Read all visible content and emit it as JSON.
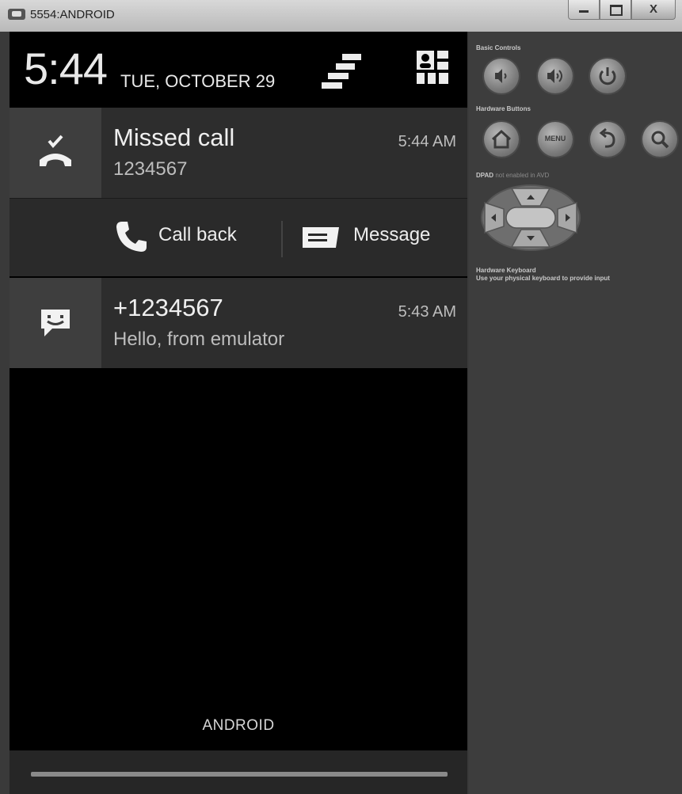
{
  "window": {
    "title": "5554:ANDROID",
    "close_glyph": "X"
  },
  "status_bar": {
    "time": "5:44",
    "date": "TUE, OCTOBER 29"
  },
  "notifications": [
    {
      "icon": "missed-call-icon",
      "title": "Missed call",
      "text": "1234567",
      "time": "5:44 AM"
    },
    {
      "icon": "sms-icon",
      "title": "+1234567",
      "text": "Hello, from emulator",
      "time": "5:43 AM"
    }
  ],
  "actions": {
    "call_back": "Call back",
    "message": "Message"
  },
  "footer": {
    "carrier": "ANDROID"
  },
  "controls": {
    "basic_controls_label": "Basic Controls",
    "hardware_buttons_label": "Hardware Buttons",
    "menu_label": "MENU",
    "dpad_label": "DPAD",
    "dpad_note": "not enabled in AVD",
    "keyboard_label": "Hardware Keyboard",
    "keyboard_note": "Use your physical keyboard to provide input"
  }
}
